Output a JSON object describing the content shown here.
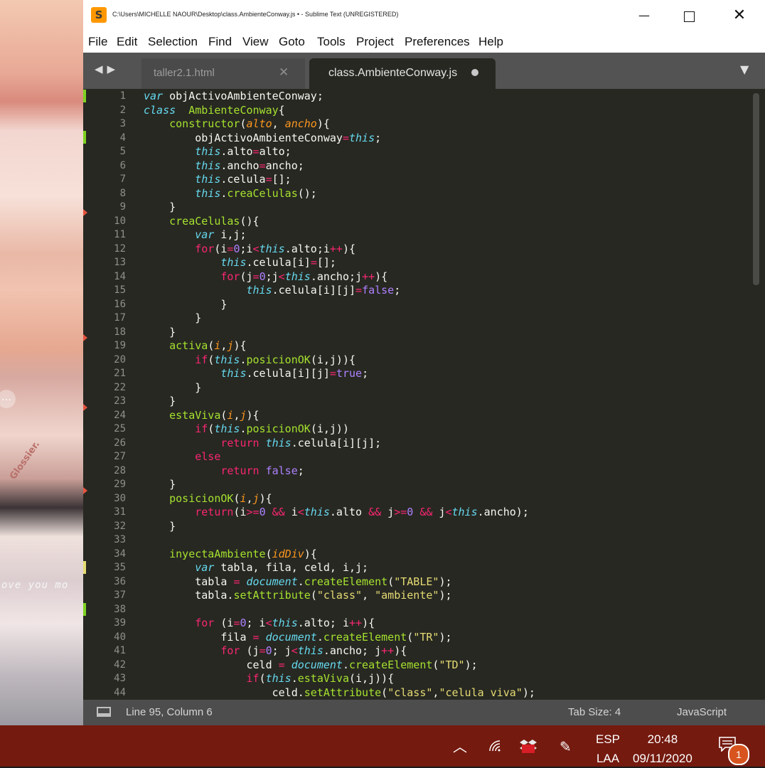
{
  "window": {
    "title": "C:\\Users\\MICHELLE NAOUR\\Desktop\\class.AmbienteConway.js • - Sublime Text (UNREGISTERED)",
    "app_icon": "S",
    "controls": {
      "minimize": "—",
      "maximize": "",
      "close": "✕"
    }
  },
  "menu": [
    "File",
    "Edit",
    "Selection",
    "Find",
    "View",
    "Goto",
    "Tools",
    "Project",
    "Preferences",
    "Help"
  ],
  "tabs": {
    "nav_arrows": "◀▶",
    "inactive": {
      "label": "taller2.1.html",
      "close": "✕"
    },
    "active": {
      "label": "class.AmbienteConway.js"
    },
    "overflow": "▼"
  },
  "editor": {
    "line_numbers": [
      "1",
      "2",
      "3",
      "4",
      "5",
      "6",
      "7",
      "8",
      "9",
      "10",
      "11",
      "12",
      "13",
      "14",
      "15",
      "16",
      "17",
      "18",
      "19",
      "20",
      "21",
      "22",
      "23",
      "24",
      "25",
      "26",
      "27",
      "28",
      "29",
      "30",
      "31",
      "32",
      "33",
      "34",
      "35",
      "36",
      "37",
      "38",
      "39",
      "40",
      "41",
      "42",
      "43",
      "44"
    ],
    "code_lines": [
      "var objActivoAmbienteConway;",
      "class  AmbienteConway{",
      "    constructor(alto, ancho){",
      "        objActivoAmbienteConway=this;",
      "        this.alto=alto;",
      "        this.ancho=ancho;",
      "        this.celula=[];",
      "        this.creaCelulas();",
      "    }",
      "    creaCelulas(){",
      "        var i,j;",
      "        for(i=0;i<this.alto;i++){",
      "            this.celula[i]=[];",
      "            for(j=0;j<this.ancho;j++){",
      "                this.celula[i][j]=false;",
      "            }",
      "        }",
      "    }",
      "    activa(i,j){",
      "        if(this.posicionOK(i,j)){",
      "            this.celula[i][j]=true;",
      "        }",
      "    }",
      "    estaViva(i,j){",
      "        if(this.posicionOK(i,j))",
      "            return this.celula[i][j];",
      "        else",
      "            return false;",
      "    }",
      "    posicionOK(i,j){",
      "        return(i>=0 && i<this.alto && j>=0 && j<this.ancho);",
      "    }",
      "",
      "    inyectaAmbiente(idDiv){",
      "        var tabla, fila, celd, i,j;",
      "        tabla = document.createElement(\"TABLE\");",
      "        tabla.setAttribute(\"class\", \"ambiente\");",
      "",
      "        for (i=0; i<this.alto; i++){",
      "            fila = document.createElement(\"TR\");",
      "            for (j=0; j<this.ancho; j++){",
      "                celd = document.createElement(\"TD\");",
      "                if(this.estaViva(i,j)){",
      "                    celd.setAttribute(\"class\",\"celula viva\");"
    ]
  },
  "status": {
    "position": "Line 95, Column 6",
    "tab_size": "Tab Size: 4",
    "syntax": "JavaScript"
  },
  "taskbar": {
    "language_top": "ESP",
    "language_bottom": "LAA",
    "time": "20:48",
    "date": "09/11/2020",
    "notification_count": "1"
  },
  "wallpaper": {
    "overlay_text": "ove you mo",
    "brand_text": "Glossier."
  },
  "colors": {
    "editor_bg": "#272822",
    "keyword": "#f92672",
    "function": "#a6e22e",
    "string": "#e6db74",
    "number": "#ae81ff",
    "storage": "#66d9ef",
    "param": "#fd971f",
    "taskbar": "#741a0f"
  }
}
